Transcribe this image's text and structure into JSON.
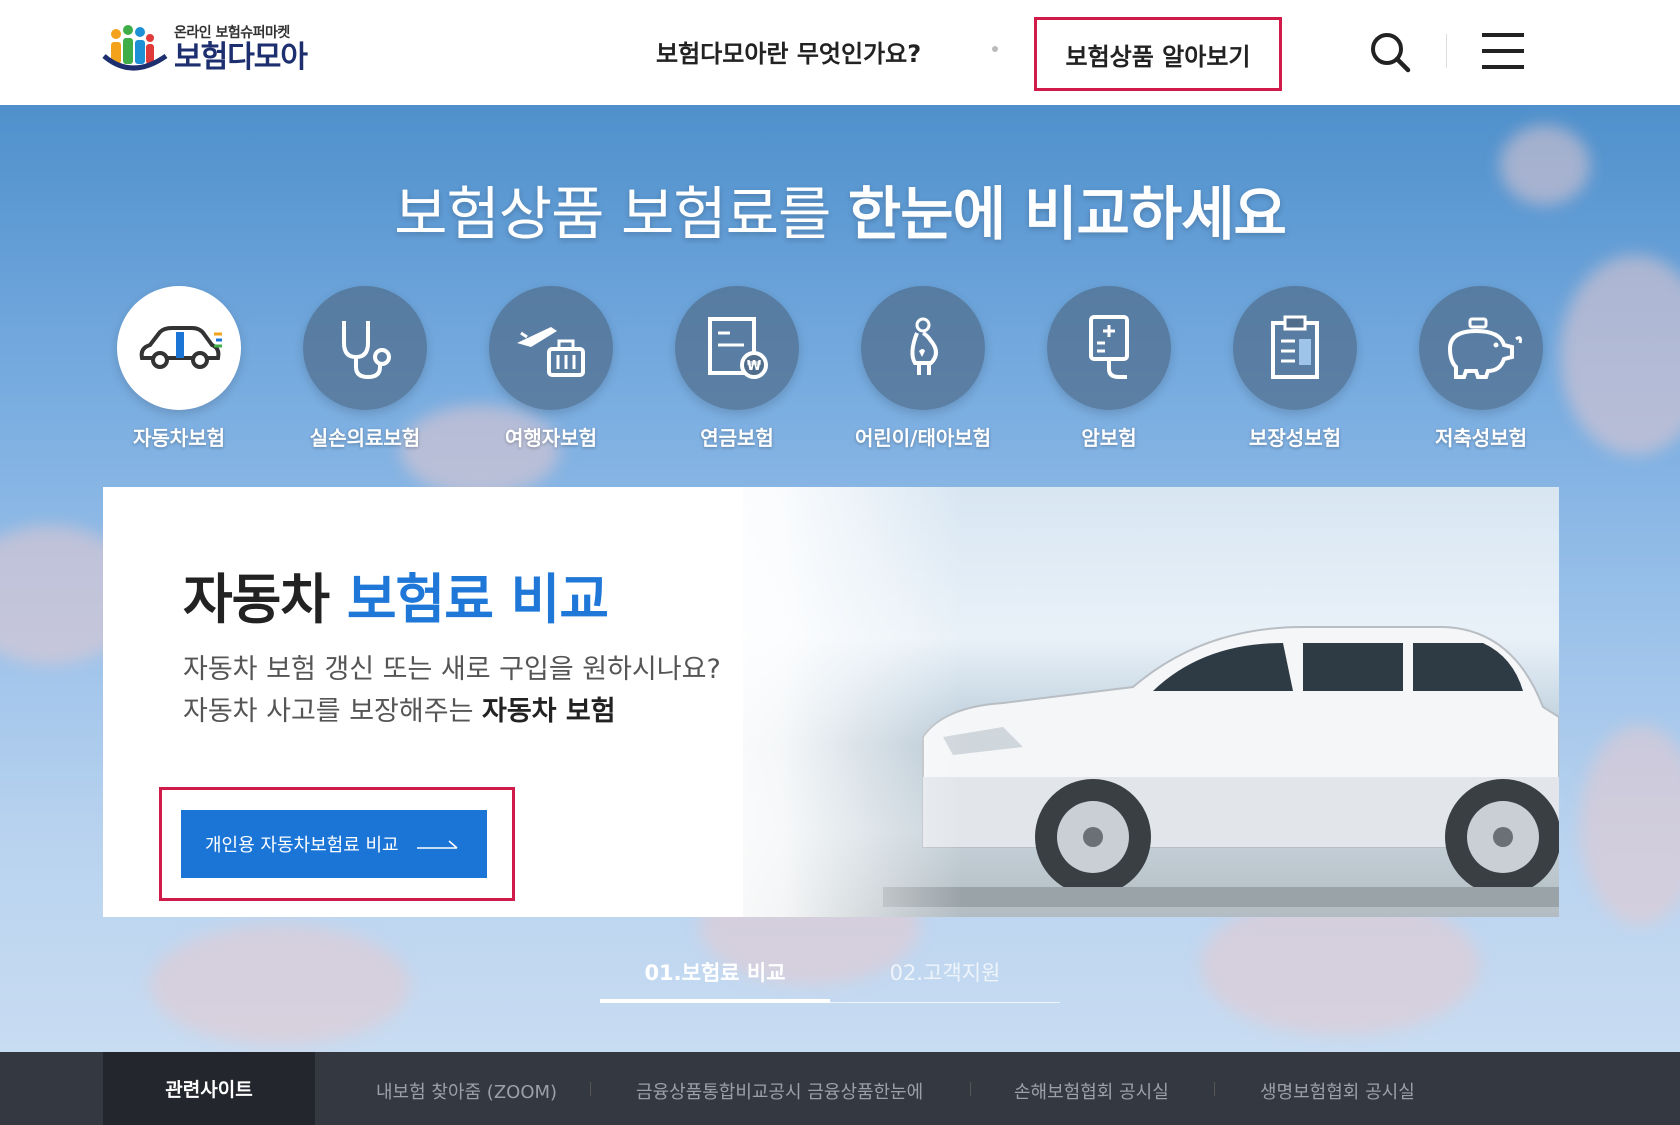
{
  "header": {
    "logo_sub": "온라인 보험슈퍼마켓",
    "logo_main": "보험다모아",
    "nav_what": "보험다모아란 무엇인가요?",
    "nav_products": "보험상품 알아보기",
    "search_icon": "search-icon",
    "menu_icon": "hamburger-menu-icon"
  },
  "hero": {
    "title_light": "보험상품 보험료를 ",
    "title_bold": "한눈에 비교하세요"
  },
  "categories": [
    {
      "label": "자동차보험",
      "icon": "car-icon",
      "active": true
    },
    {
      "label": "실손의료보험",
      "icon": "stethoscope-icon",
      "active": false
    },
    {
      "label": "여행자보험",
      "icon": "airplane-luggage-icon",
      "active": false
    },
    {
      "label": "연금보험",
      "icon": "pension-document-icon",
      "active": false
    },
    {
      "label": "어린이/태아보험",
      "icon": "pregnant-woman-icon",
      "active": false
    },
    {
      "label": "암보험",
      "icon": "iv-bag-icon",
      "active": false
    },
    {
      "label": "보장성보험",
      "icon": "clipboard-icon",
      "active": false
    },
    {
      "label": "저축성보험",
      "icon": "piggy-bank-icon",
      "active": false
    }
  ],
  "card": {
    "title_dark": "자동차 ",
    "title_blue": "보험료 비교",
    "desc_line1": "자동차 보험 갱신 또는 새로 구입을 원하시나요?",
    "desc_line2_normal": "자동차 사고를 보장해주는 ",
    "desc_line2_bold": "자동차 보험",
    "cta_label": "개인용 자동차보험료 비교"
  },
  "tabs": [
    {
      "label": "01.보험료 비교",
      "active": true
    },
    {
      "label": "02.고객지원",
      "active": false
    }
  ],
  "footer": {
    "label": "관련사이트",
    "links": [
      "내보험 찾아줌 (ZOOM)",
      "금융상품통합비교공시 금융상품한눈에",
      "손해보험협회 공시실",
      "생명보험협회 공시실"
    ]
  },
  "colors": {
    "accent_blue": "#1b75d6",
    "highlight_red": "#d01a4a",
    "footer_bg": "#343840"
  }
}
